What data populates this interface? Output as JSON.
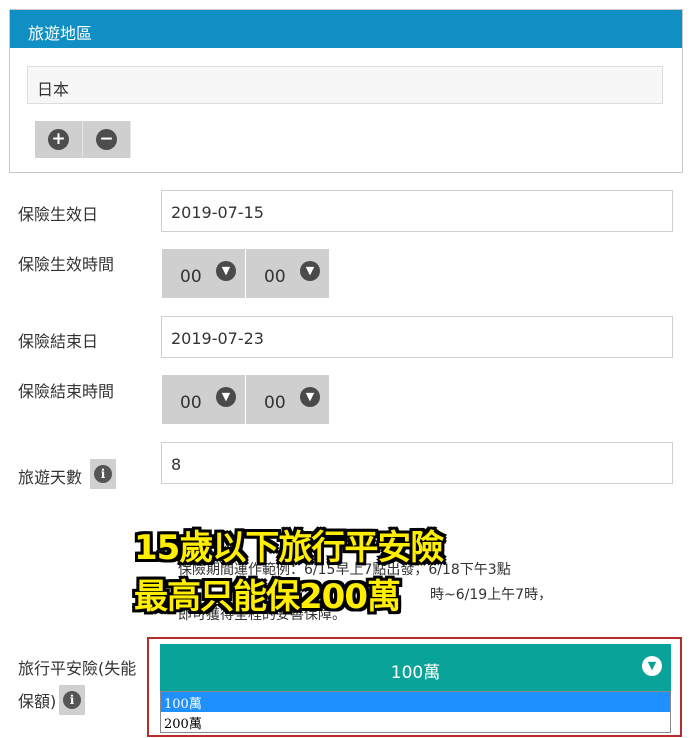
{
  "region": {
    "title": "旅遊地區",
    "value": "日本",
    "add_icon": "plus-circle-icon",
    "remove_icon": "minus-circle-icon"
  },
  "start_date": {
    "label": "保險生效日",
    "value": "2019-07-15"
  },
  "start_time": {
    "label": "保險生效時間",
    "hour": "00",
    "minute": "00"
  },
  "end_date": {
    "label": "保險結束日",
    "value": "2019-07-23"
  },
  "end_time": {
    "label": "保險結束時間",
    "hour": "00",
    "minute": "00"
  },
  "days": {
    "label": "旅遊天數",
    "value": "8"
  },
  "notes": {
    "line1": "保險期間運作範例：6/15早上7點出發，6/18下午3點",
    "line2": "時~6/19上午7時，",
    "line3": "即可獲得全程的妥善保障。"
  },
  "overlay": {
    "line1": "15歲以下旅行平安險",
    "line2": "最高只能保200萬"
  },
  "amount": {
    "label_line1": "旅行平安險(失能",
    "label_line2": "保額)",
    "selected": "100萬",
    "options": [
      "100萬",
      "200萬"
    ]
  },
  "colors": {
    "header_blue": "#0f8fc4",
    "select_teal": "#0aa39a",
    "option_highlight": "#1e90ff",
    "overlay_yellow": "#ffee00"
  }
}
